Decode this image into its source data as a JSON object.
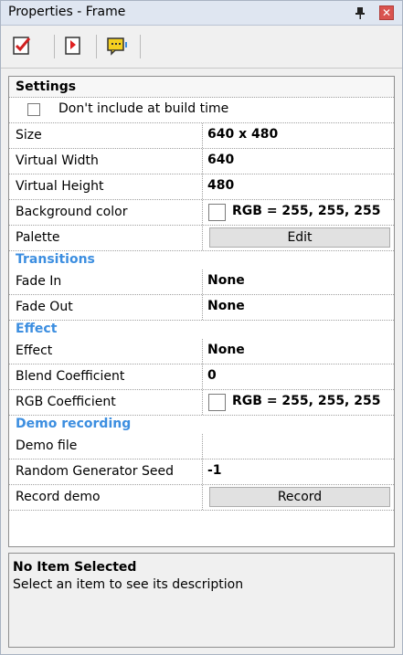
{
  "window": {
    "title": "Properties - Frame"
  },
  "toolbar": {
    "icons": [
      "properties-check-icon",
      "bookmark-doc-icon",
      "comment-icon"
    ]
  },
  "settings": {
    "header": "Settings",
    "build_checkbox": {
      "label": "Don't include at build time",
      "checked": false
    },
    "size": {
      "label": "Size",
      "value": "640 x 480"
    },
    "virtual_width": {
      "label": "Virtual Width",
      "value": "640"
    },
    "virtual_height": {
      "label": "Virtual Height",
      "value": "480"
    },
    "background_color": {
      "label": "Background color",
      "value": "RGB = 255, 255, 255",
      "swatch": "#ffffff"
    },
    "palette": {
      "label": "Palette",
      "button": "Edit"
    }
  },
  "transitions": {
    "header": "Transitions",
    "fade_in": {
      "label": "Fade In",
      "value": "None"
    },
    "fade_out": {
      "label": "Fade Out",
      "value": "None"
    }
  },
  "effect": {
    "header": "Effect",
    "effect": {
      "label": "Effect",
      "value": "None"
    },
    "blend": {
      "label": "Blend Coefficient",
      "value": "0"
    },
    "rgb": {
      "label": "RGB Coefficient",
      "value": "RGB = 255, 255, 255",
      "swatch": "#ffffff"
    }
  },
  "demo": {
    "header": "Demo recording",
    "demo_file": {
      "label": "Demo file",
      "value": ""
    },
    "seed": {
      "label": "Random Generator Seed",
      "value": "-1"
    },
    "record": {
      "label": "Record demo",
      "button": "Record"
    }
  },
  "description": {
    "title": "No Item Selected",
    "text": "Select an item to see its description"
  },
  "colors": {
    "category": "#3c8ee0",
    "close": "#d9534f"
  }
}
